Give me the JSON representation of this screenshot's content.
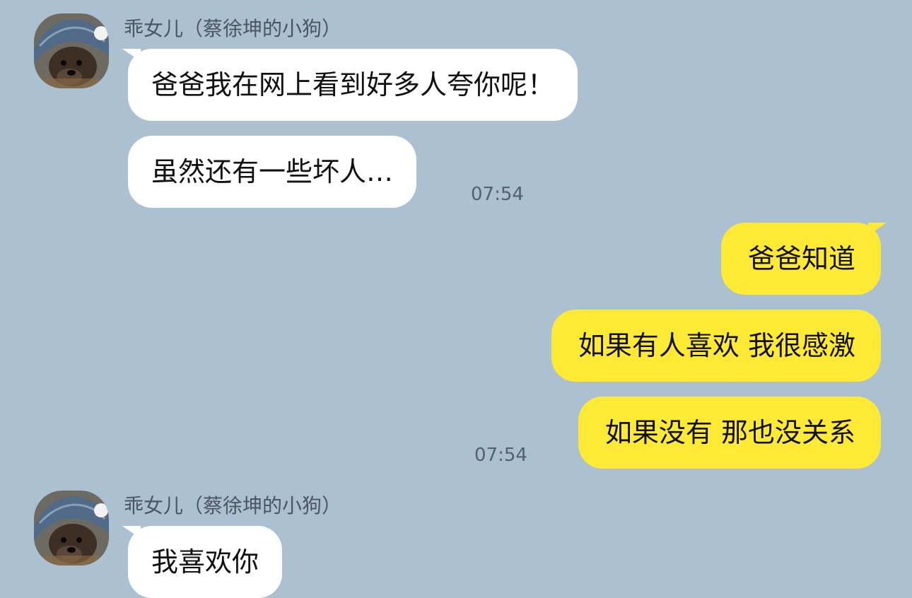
{
  "sender_name": "乖女儿（蔡徐坤的小狗）",
  "avatar_icon": "dog-avatar-icon",
  "colors": {
    "background": "#abc1d1",
    "incoming_bubble": "#ffffff",
    "outgoing_bubble": "#fee934"
  },
  "messages": [
    {
      "side": "in",
      "text": "爸爸我在网上看到好多人夸你呢！"
    },
    {
      "side": "in",
      "text": "虽然还有一些坏人…",
      "time": "07:54"
    },
    {
      "side": "out",
      "text": "爸爸知道"
    },
    {
      "side": "out",
      "text": "如果有人喜欢 我很感激"
    },
    {
      "side": "out",
      "text": "如果没有 那也没关系",
      "time": "07:54"
    },
    {
      "side": "in",
      "text": "我喜欢你"
    }
  ]
}
